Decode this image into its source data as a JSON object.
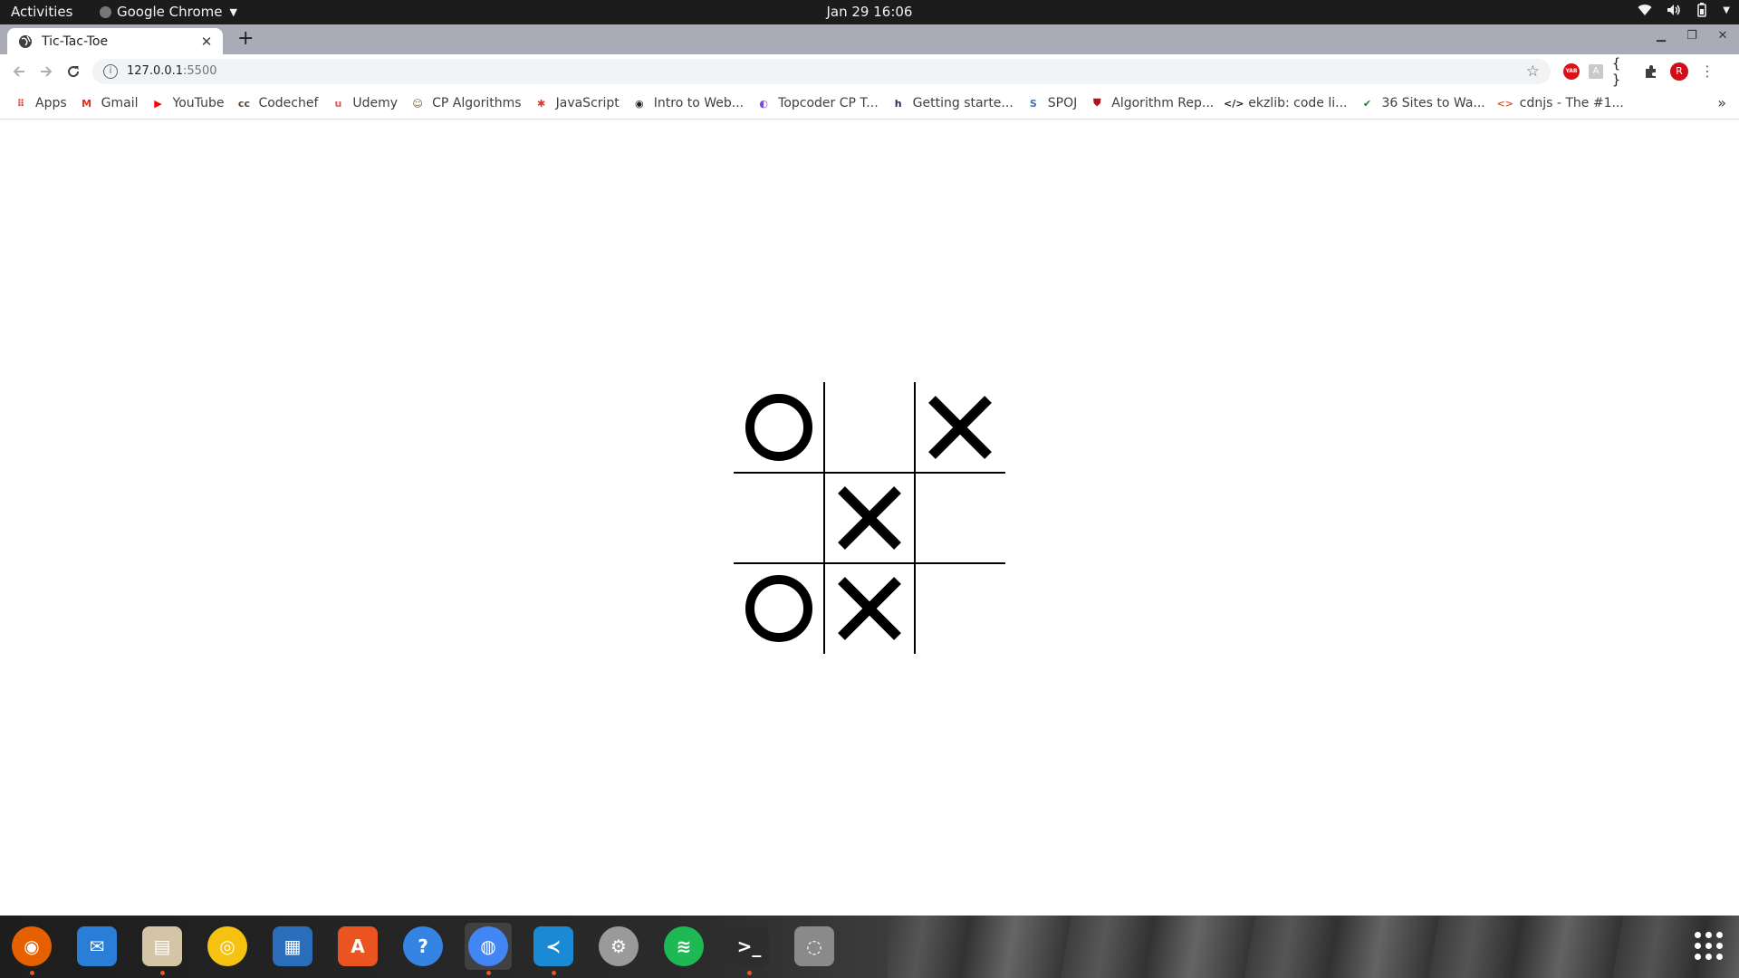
{
  "topbar": {
    "activities": "Activities",
    "app_name": "Google Chrome",
    "clock": "Jan 29  16:06"
  },
  "browser": {
    "tab_title": "Tic-Tac-Toe",
    "url_host": "127.0.0.1",
    "url_port": ":5500",
    "avatar_letter": "R",
    "yab_label": "YAB"
  },
  "bookmarks": [
    {
      "label": "Apps",
      "icon": "apps-grid-icon",
      "color": "#e94235"
    },
    {
      "label": "Gmail",
      "icon": "gmail-icon",
      "color": "#d93025"
    },
    {
      "label": "YouTube",
      "icon": "youtube-icon",
      "color": "#ff0000"
    },
    {
      "label": "Codechef",
      "icon": "codechef-icon",
      "color": "#5b4638"
    },
    {
      "label": "Udemy",
      "icon": "udemy-icon",
      "color": "#ec5252"
    },
    {
      "label": "CP Algorithms",
      "icon": "cp-algorithms-icon",
      "color": "#6b5a3a"
    },
    {
      "label": "JavaScript",
      "icon": "javascript-icon",
      "color": "#d83a2a"
    },
    {
      "label": "Intro to Web...",
      "icon": "globe-icon",
      "color": "#202124"
    },
    {
      "label": "Topcoder CP T...",
      "icon": "topcoder-icon",
      "color": "#7b4bd1"
    },
    {
      "label": "Getting starte...",
      "icon": "hashnode-icon",
      "color": "#2c2c54"
    },
    {
      "label": "SPOJ",
      "icon": "spoj-icon",
      "color": "#3b73b9"
    },
    {
      "label": "Algorithm Rep...",
      "icon": "shield-icon",
      "color": "#b3121a"
    },
    {
      "label": "ekzlib: code li...",
      "icon": "code-icon",
      "color": "#202124"
    },
    {
      "label": "36 Sites to Wa...",
      "icon": "check-icon",
      "color": "#1a7f37"
    },
    {
      "label": "cdnjs - The #1...",
      "icon": "cdnjs-icon",
      "color": "#e5532d"
    }
  ],
  "game": {
    "board": [
      "O",
      "",
      "X",
      "",
      "X",
      "",
      "O",
      "X",
      ""
    ]
  },
  "dock": [
    {
      "name": "firefox",
      "color": "#e66000",
      "running": true
    },
    {
      "name": "thunderbird",
      "color": "#2a7ed8",
      "running": false
    },
    {
      "name": "files",
      "color": "#d4c5a6",
      "running": true
    },
    {
      "name": "rhythmbox",
      "color": "#f5c211",
      "running": false
    },
    {
      "name": "libreoffice-writer",
      "color": "#2a6ebb",
      "running": false
    },
    {
      "name": "software-center",
      "color": "#e95420",
      "running": false
    },
    {
      "name": "help",
      "color": "#3584e4",
      "running": false
    },
    {
      "name": "chrome",
      "color": "#4285f4",
      "running": true
    },
    {
      "name": "vscode",
      "color": "#1a8ad4",
      "running": true
    },
    {
      "name": "settings",
      "color": "#9a9a9a",
      "running": false
    },
    {
      "name": "spotify",
      "color": "#1db954",
      "running": false
    },
    {
      "name": "terminal",
      "color": "#2d2d2d",
      "running": true
    },
    {
      "name": "disk-utility",
      "color": "#8a8a8a",
      "running": false
    }
  ]
}
